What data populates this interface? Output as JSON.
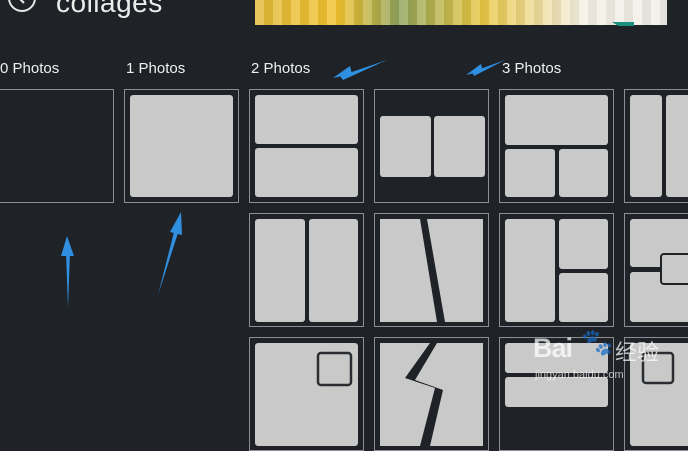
{
  "header": {
    "title": "collages",
    "back_icon": "back-arrow-icon"
  },
  "sections": [
    {
      "label": "0 Photos"
    },
    {
      "label": "1 Photos"
    },
    {
      "label": "2 Photos"
    },
    {
      "label": "3 Photos"
    }
  ],
  "templates": [
    {
      "name": "blank"
    },
    {
      "name": "single"
    },
    {
      "name": "two-horizontal"
    },
    {
      "name": "two-side-by-side"
    },
    {
      "name": "three-top-split-bottom"
    },
    {
      "name": "three-vertical-partial"
    },
    {
      "name": "two-columns"
    },
    {
      "name": "two-diagonal"
    },
    {
      "name": "three-left-split-right"
    },
    {
      "name": "three-overlap-partial"
    },
    {
      "name": "two-inset"
    },
    {
      "name": "two-zigzag"
    },
    {
      "name": "three-rows-partial"
    },
    {
      "name": "two-inset-partial"
    }
  ],
  "watermark": {
    "logo": "Bai",
    "paw": "🐾",
    "suffix": "经验",
    "url": "jingyan.baidu.com"
  },
  "colors": {
    "background": "#1f2226",
    "tile_border": "#8b8f95",
    "tile_fill": "#c9c9c9",
    "arrow": "#2f8fe0",
    "banner_accent": "#1b8e7d"
  }
}
